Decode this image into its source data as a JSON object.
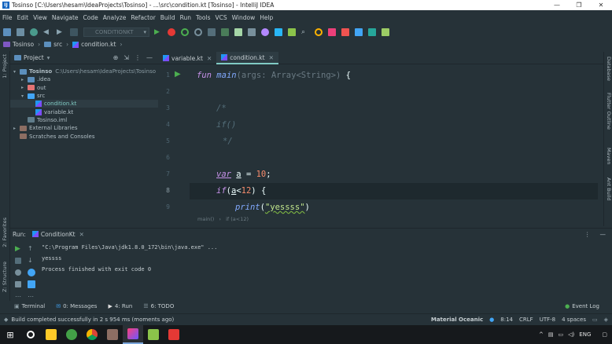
{
  "window": {
    "title": "Tosinso [C:\\Users\\hesam\\IdeaProjects\\Tosinso] - ...\\src\\condition.kt [Tosinso] - IntelliJ IDEA",
    "minimize": "—",
    "maximize": "❐",
    "close": "✕"
  },
  "menu": [
    "File",
    "Edit",
    "View",
    "Navigate",
    "Code",
    "Analyze",
    "Refactor",
    "Build",
    "Run",
    "Tools",
    "VCS",
    "Window",
    "Help"
  ],
  "toolbar": {
    "run_config": "CONDITIONKT"
  },
  "navbar": {
    "project": "Tosinso",
    "folder": "src",
    "file": "condition.kt"
  },
  "left_strip": {
    "project_label": "1: Project",
    "favorites_label": "2: Favorites",
    "structure_label": "Z: Structure"
  },
  "project_panel": {
    "title": "Project",
    "tree": [
      {
        "label": "Tosinso",
        "extra": "C:\\Users\\hesam\\IdeaProjects\\Tosinso",
        "depth": 0,
        "arrow": "▾",
        "kind": "project"
      },
      {
        "label": ".idea",
        "extra": "",
        "depth": 1,
        "arrow": "▸",
        "kind": "folder"
      },
      {
        "label": "out",
        "extra": "",
        "depth": 1,
        "arrow": "▸",
        "kind": "folder-orange"
      },
      {
        "label": "src",
        "extra": "",
        "depth": 1,
        "arrow": "▾",
        "kind": "folder-blue"
      },
      {
        "label": "condition.kt",
        "extra": "",
        "depth": 2,
        "arrow": "",
        "kind": "kt",
        "selected": true
      },
      {
        "label": "variable.kt",
        "extra": "",
        "depth": 2,
        "arrow": "",
        "kind": "kt"
      },
      {
        "label": "Tosinso.iml",
        "extra": "",
        "depth": 1,
        "arrow": "",
        "kind": "iml"
      },
      {
        "label": "External Libraries",
        "extra": "",
        "depth": 0,
        "arrow": "▸",
        "kind": "lib"
      },
      {
        "label": "Scratches and Consoles",
        "extra": "",
        "depth": 0,
        "arrow": "",
        "kind": "scratch"
      }
    ]
  },
  "editor": {
    "tabs": [
      {
        "label": "variable.kt",
        "active": false
      },
      {
        "label": "condition.kt",
        "active": true
      }
    ],
    "line_numbers": [
      "1",
      "2",
      "3",
      "4",
      "5",
      "6",
      "7",
      "8",
      "9"
    ],
    "lines": {
      "l1": {
        "kw": "fun",
        "name": "main",
        "params": "(args: Array<String>)",
        "brace": " {"
      },
      "l3": "/*",
      "l4": "if()",
      "l5": "*/",
      "l7": {
        "kw": "var",
        "name": "a",
        "assign": " = ",
        "num": "10",
        "semi": ";"
      },
      "l8": {
        "kw": "if",
        "paren_open": "(",
        "var": "a",
        "op": "<",
        "num": "12",
        "paren_close": ")",
        "brace": " {"
      },
      "l9": {
        "fn": "print",
        "open": "(",
        "str": "\"yessss\"",
        "close": ")"
      }
    },
    "breadcrumb": [
      "main()",
      "if (a<12)"
    ]
  },
  "right_strip": [
    "Database",
    "Flutter Outline",
    "Maven",
    "Ant Build"
  ],
  "run_panel": {
    "label": "Run:",
    "tab": "ConditionKt",
    "console": [
      "\"C:\\Program Files\\Java\\jdk1.8.0_172\\bin\\java.exe\" ...",
      "yessss",
      "",
      "Process finished with exit code 0"
    ]
  },
  "bottom_tabs": [
    {
      "label": "Terminal",
      "icon": "terminal-icon"
    },
    {
      "label": "0: Messages",
      "icon": "messages-icon"
    },
    {
      "label": "4: Run",
      "icon": "run-icon"
    },
    {
      "label": "6: TODO",
      "icon": "todo-icon"
    }
  ],
  "event_log": "Event Log",
  "status": {
    "message": "Build completed successfully in 2 s 954 ms (moments ago)",
    "theme": "Material Oceanic",
    "position": "8:14",
    "line_sep": "CRLF",
    "encoding": "UTF-8",
    "indent": "4 spaces"
  },
  "taskbar": {
    "lang": "ENG"
  },
  "colors": {
    "accent": "#80cbc4",
    "background": "#263238",
    "keyword": "#c792ea",
    "function": "#82aaff",
    "string": "#c3e88d",
    "number": "#f78c6c",
    "comment": "#546e7a"
  }
}
